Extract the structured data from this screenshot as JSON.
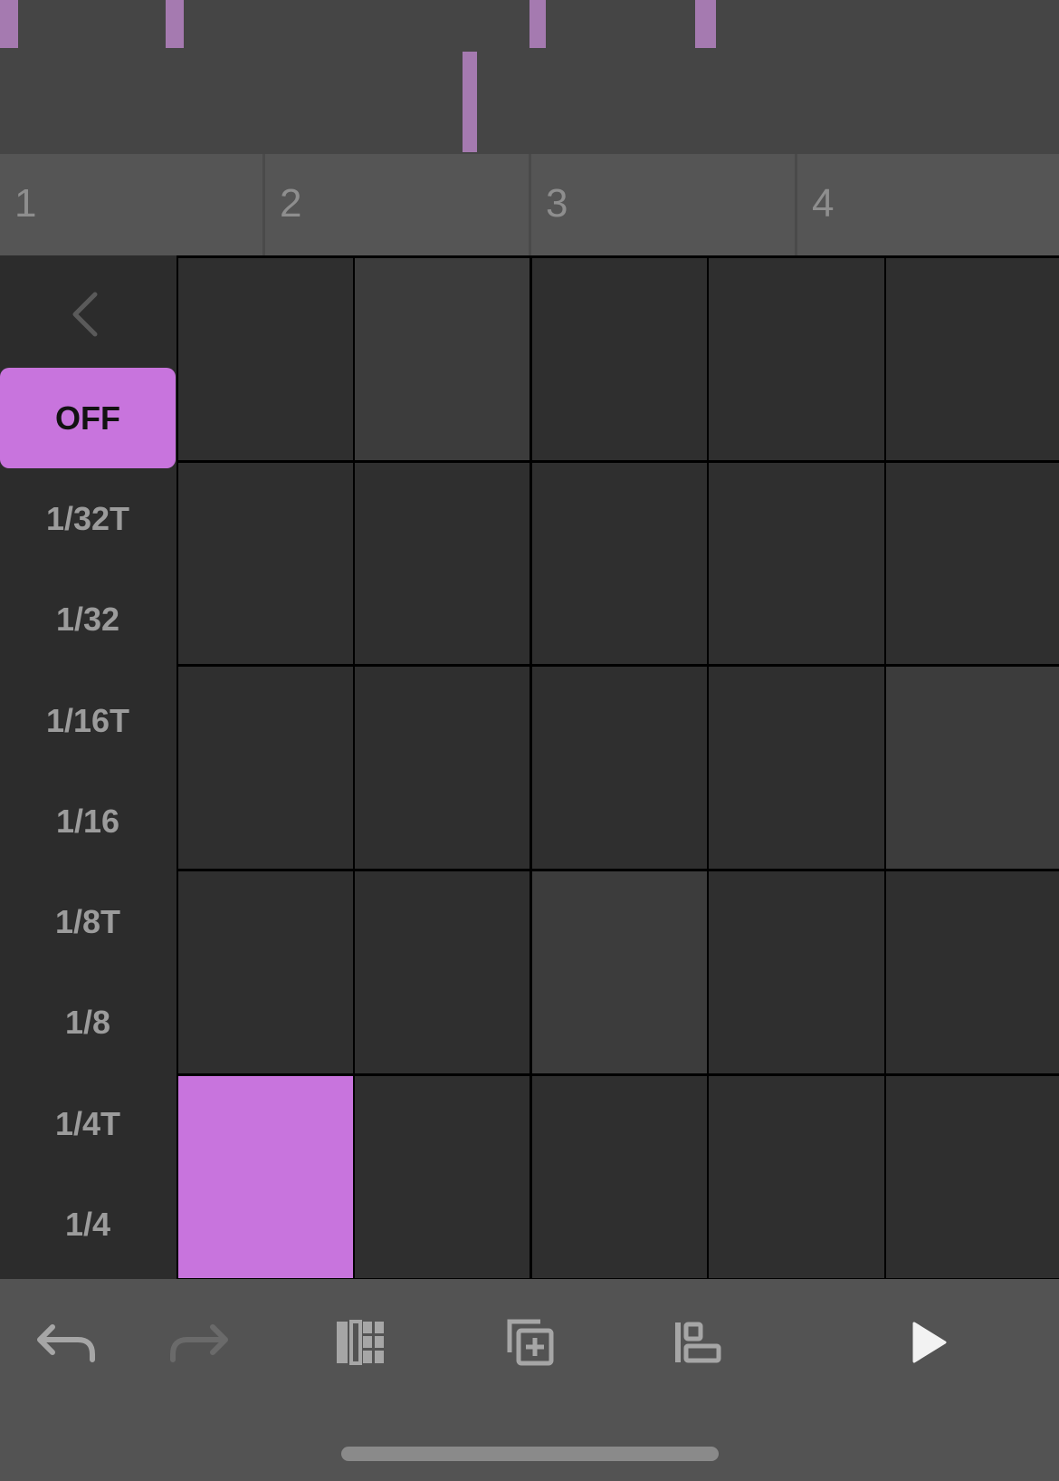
{
  "overview": {
    "notes_top_row": [
      1,
      2,
      3,
      4
    ],
    "notes_bottom_row": [
      1
    ]
  },
  "ruler": {
    "bars": [
      "1",
      "2",
      "3",
      "4"
    ]
  },
  "sidebar": {
    "back_icon": "chevron-left-icon",
    "rates": [
      "OFF",
      "1/32T",
      "1/32",
      "1/16T",
      "1/16",
      "1/8T",
      "1/8",
      "1/4T",
      "1/4"
    ],
    "selected": "OFF"
  },
  "pads": {
    "rows": 5,
    "cols": 5,
    "lit": [
      [
        0,
        1
      ],
      [
        2,
        4
      ],
      [
        3,
        2
      ]
    ],
    "on": [
      [
        4,
        0
      ]
    ]
  },
  "toolbar": {
    "icons": [
      "undo-icon",
      "redo-icon",
      "pad-layout-icon",
      "duplicate-icon",
      "align-icon",
      "play-icon"
    ]
  },
  "colors": {
    "accent": "#c874dd",
    "note_marker": "#a57ab0",
    "pad": "#2f2f2f",
    "pad_lit": "#3c3c3c"
  }
}
